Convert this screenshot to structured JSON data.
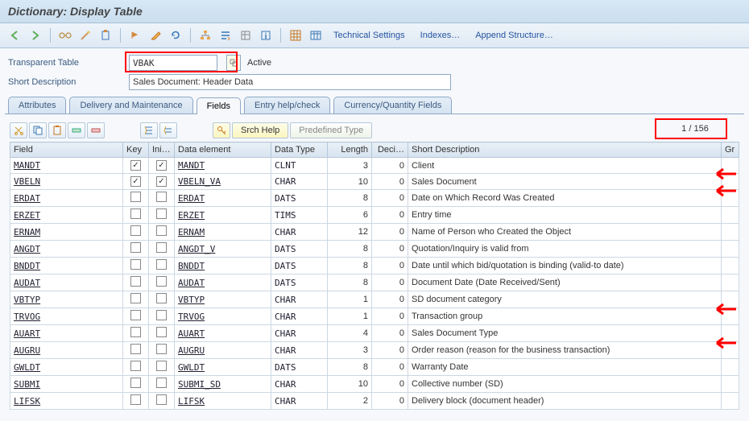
{
  "title": "Dictionary: Display Table",
  "toolbar_links": {
    "tech": "Technical Settings",
    "indexes": "Indexes…",
    "append": "Append Structure…"
  },
  "header": {
    "table_label": "Transparent Table",
    "table_name": "VBAK",
    "status": "Active",
    "short_desc_label": "Short Description",
    "short_desc": "Sales Document: Header Data"
  },
  "tabs": [
    "Attributes",
    "Delivery and Maintenance",
    "Fields",
    "Entry help/check",
    "Currency/Quantity Fields"
  ],
  "grid_buttons": {
    "srch_help": "Srch Help",
    "predef_type": "Predefined Type"
  },
  "counter": "1  /  156",
  "columns": [
    "Field",
    "Key",
    "Ini…",
    "Data element",
    "Data Type",
    "Length",
    "Deci…",
    "Short Description",
    "Gr"
  ],
  "rows": [
    {
      "field": "MANDT",
      "key": true,
      "ini": true,
      "elem": "MANDT",
      "type": "CLNT",
      "len": 3,
      "dec": 0,
      "desc": "Client"
    },
    {
      "field": "VBELN",
      "key": true,
      "ini": true,
      "elem": "VBELN_VA",
      "type": "CHAR",
      "len": 10,
      "dec": 0,
      "desc": "Sales Document"
    },
    {
      "field": "ERDAT",
      "key": false,
      "ini": false,
      "elem": "ERDAT",
      "type": "DATS",
      "len": 8,
      "dec": 0,
      "desc": "Date on Which Record Was Created"
    },
    {
      "field": "ERZET",
      "key": false,
      "ini": false,
      "elem": "ERZET",
      "type": "TIMS",
      "len": 6,
      "dec": 0,
      "desc": "Entry time"
    },
    {
      "field": "ERNAM",
      "key": false,
      "ini": false,
      "elem": "ERNAM",
      "type": "CHAR",
      "len": 12,
      "dec": 0,
      "desc": "Name of Person who Created the Object"
    },
    {
      "field": "ANGDT",
      "key": false,
      "ini": false,
      "elem": "ANGDT_V",
      "type": "DATS",
      "len": 8,
      "dec": 0,
      "desc": "Quotation/Inquiry is valid from"
    },
    {
      "field": "BNDDT",
      "key": false,
      "ini": false,
      "elem": "BNDDT",
      "type": "DATS",
      "len": 8,
      "dec": 0,
      "desc": "Date until which bid/quotation is binding (valid-to date)"
    },
    {
      "field": "AUDAT",
      "key": false,
      "ini": false,
      "elem": "AUDAT",
      "type": "DATS",
      "len": 8,
      "dec": 0,
      "desc": "Document Date (Date Received/Sent)"
    },
    {
      "field": "VBTYP",
      "key": false,
      "ini": false,
      "elem": "VBTYP",
      "type": "CHAR",
      "len": 1,
      "dec": 0,
      "desc": "SD document category"
    },
    {
      "field": "TRVOG",
      "key": false,
      "ini": false,
      "elem": "TRVOG",
      "type": "CHAR",
      "len": 1,
      "dec": 0,
      "desc": "Transaction group"
    },
    {
      "field": "AUART",
      "key": false,
      "ini": false,
      "elem": "AUART",
      "type": "CHAR",
      "len": 4,
      "dec": 0,
      "desc": "Sales Document Type"
    },
    {
      "field": "AUGRU",
      "key": false,
      "ini": false,
      "elem": "AUGRU",
      "type": "CHAR",
      "len": 3,
      "dec": 0,
      "desc": "Order reason (reason for the business transaction)"
    },
    {
      "field": "GWLDT",
      "key": false,
      "ini": false,
      "elem": "GWLDT",
      "type": "DATS",
      "len": 8,
      "dec": 0,
      "desc": "Warranty Date"
    },
    {
      "field": "SUBMI",
      "key": false,
      "ini": false,
      "elem": "SUBMI_SD",
      "type": "CHAR",
      "len": 10,
      "dec": 0,
      "desc": "Collective number (SD)"
    },
    {
      "field": "LIFSK",
      "key": false,
      "ini": false,
      "elem": "LIFSK",
      "type": "CHAR",
      "len": 2,
      "dec": 0,
      "desc": "Delivery block (document header)"
    }
  ],
  "arrow_rows": [
    0,
    1,
    8,
    10
  ]
}
